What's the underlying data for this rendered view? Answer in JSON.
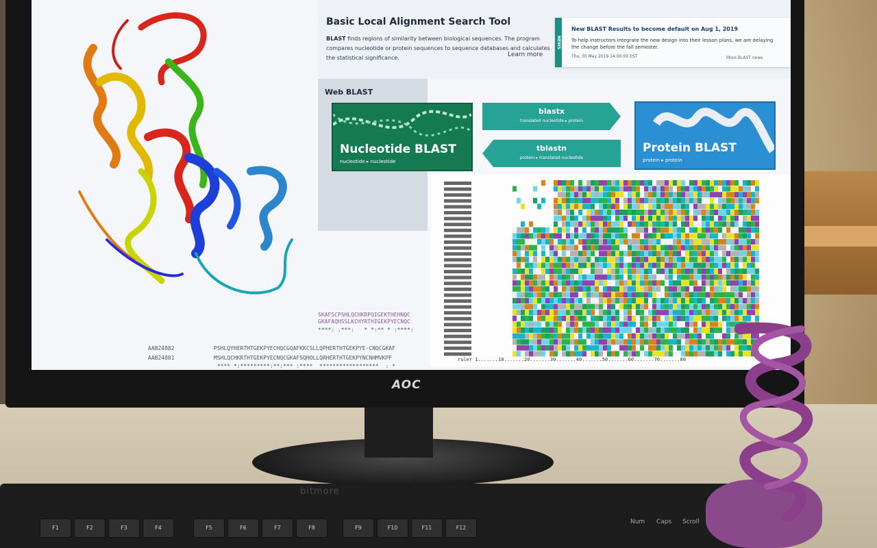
{
  "monitor": {
    "brand": "AOC"
  },
  "keyboard": {
    "brand": "bitmore",
    "keys": [
      "F1",
      "F2",
      "F3",
      "F4",
      "F5",
      "F6",
      "F7",
      "F8",
      "F9",
      "F10",
      "F11",
      "F12"
    ],
    "indicators": [
      "Num",
      "Caps",
      "Scroll"
    ]
  },
  "blast": {
    "title": "Basic Local Alignment Search Tool",
    "description_bold": "BLAST",
    "description": " finds regions of similarity between biological sequences. The program compares nucleotide or protein sequences to sequence databases and calculates the statistical significance.",
    "learn_more": "Learn more",
    "news": {
      "side_label": "NEWS",
      "title": "New BLAST Results to become default on Aug 1, 2019",
      "body": "To help instructors integrate the new design into their lesson plans, we are delaying the change before the fall semester.",
      "date": "Thu, 30 May 2019 14:00:00 EST",
      "more": "More BLAST news"
    },
    "section_title": "Web BLAST",
    "cards": {
      "nucleotide": {
        "title": "Nucleotide BLAST",
        "sub": "nucleotide ▸ nucleotide"
      },
      "protein": {
        "title": "Protein BLAST",
        "sub": "protein ▸ protein"
      },
      "blastx": {
        "title": "blastx",
        "sub": "translated nucleotide ▸ protein"
      },
      "tblastn": {
        "title": "tblastn",
        "sub": "protein ▸ translated nucleotide"
      }
    }
  },
  "alignment": {
    "seq_a": "SKAFSCPSHLQCHKRPQIGEKTHEHNQC",
    "seq_b": "GKAFAQHSSLKCHYRTHIGEKPYECNQC",
    "cons_1": "****: .***:   * *:** * :****:",
    "acc_1": "AAB24882",
    "acc_2": "AAB24881",
    "aln_1": "PSHLQYHERTHTGEKPYECHQCGQAFKKCSLLQPHERTHTGEKPYE-CNQCGKAF",
    "aln_2": "MSHLQCHKRTHTGEKPYECNQCGKAFSQHOLLQRHERTHTGEKPYNCNHMVKPF",
    "aln_3": " **** *:*********:**:*** :****  ******************  : *",
    "ruler": "ruler 1.......10.......20.......30.......40.......50.......60.......70.......80"
  }
}
